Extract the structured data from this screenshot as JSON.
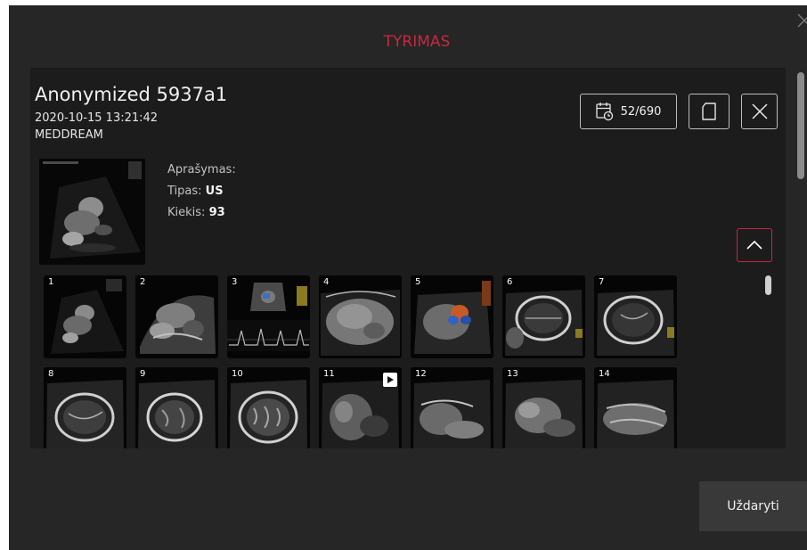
{
  "dialog": {
    "title": "TYRIMAS",
    "close_icon": "close-icon",
    "accent_color": "#c8283f"
  },
  "study": {
    "name": "Anonymized 5937a1",
    "datetime": "2020-10-15 13:21:42",
    "source": "MEDDREAM",
    "counter": "52/690",
    "description_label": "Aprašymas:",
    "description_value": "",
    "type_label": "Tipas:",
    "type_value": "US",
    "count_label": "Kiekis:",
    "count_value": "93"
  },
  "icons": {
    "counter": "calendar-history-icon",
    "copy": "copy-icon",
    "close_study": "close-icon",
    "collapse": "chevron-up-icon",
    "play": "play-icon"
  },
  "thumbnails": [
    {
      "number": "1",
      "video": false
    },
    {
      "number": "2",
      "video": false
    },
    {
      "number": "3",
      "video": false
    },
    {
      "number": "4",
      "video": false
    },
    {
      "number": "5",
      "video": false
    },
    {
      "number": "6",
      "video": false
    },
    {
      "number": "7",
      "video": false
    },
    {
      "number": "8",
      "video": false
    },
    {
      "number": "9",
      "video": false
    },
    {
      "number": "10",
      "video": false
    },
    {
      "number": "11",
      "video": true
    },
    {
      "number": "12",
      "video": false
    },
    {
      "number": "13",
      "video": false
    },
    {
      "number": "14",
      "video": false
    }
  ],
  "footer": {
    "close_label": "Uždaryti"
  }
}
